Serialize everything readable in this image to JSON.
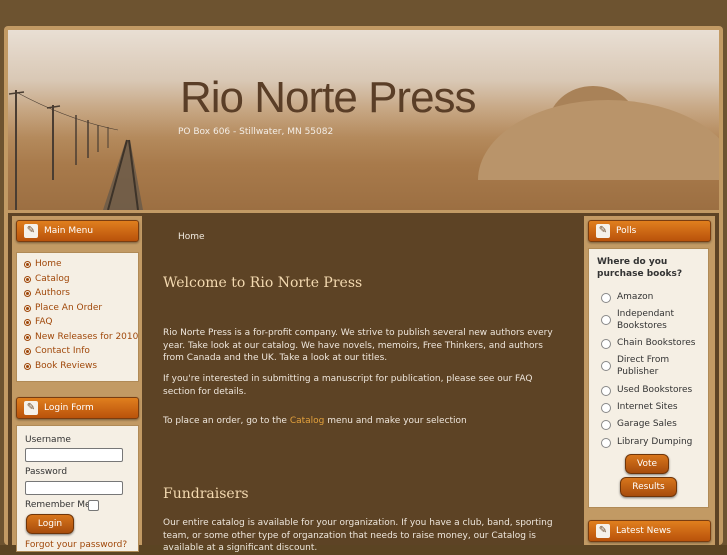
{
  "site": {
    "title": "Rio Norte Press",
    "address": "PO Box 606 - Stillwater, MN 55082"
  },
  "main_menu": {
    "title": "Main Menu",
    "items": [
      "Home",
      "Catalog",
      "Authors",
      "Place An Order",
      "FAQ",
      "New Releases for 2010",
      "Contact Info",
      "Book Reviews"
    ]
  },
  "login": {
    "title": "Login Form",
    "username_label": "Username",
    "password_label": "Password",
    "remember_label": "Remember Me",
    "login_button": "Login",
    "forgot_link": "Forgot your password?"
  },
  "breadcrumb": "Home",
  "content": {
    "welcome_title": "Welcome to Rio Norte Press",
    "intro": "Rio Norte Press is a for-profit company. We strive to publish several new authors every year. Take look at our catalog. We have novels, memoirs, Free Thinkers, and authors from Canada and the UK. Take a look at our titles.",
    "manuscript": "If you're interested in submitting a manuscript for publication, please see our FAQ section for details.",
    "order_before": "To place an order, go to the ",
    "order_link": "Catalog",
    "order_after": " menu and make your selection",
    "fundraisers_title": "Fundraisers",
    "fundraisers_text": "Our entire catalog is available for your organization.  If you have a club, band, sporting team, or some other type of organzation that needs to raise money, our Catalog is available at a significant discount."
  },
  "polls": {
    "title": "Polls",
    "question": "Where do you purchase books?",
    "options": [
      "Amazon",
      "Independant Bookstores",
      "Chain Bookstores",
      "Direct From Publisher",
      "Used Bookstores",
      "Internet Sites",
      "Garage Sales",
      "Library Dumping"
    ],
    "vote_button": "Vote",
    "results_button": "Results"
  },
  "latest_news": {
    "title": "Latest News"
  },
  "icons": {
    "module_icon": "pencil-icon",
    "list_bullet": "radio-bullet-icon"
  },
  "colors": {
    "accent": "#c9640f",
    "link": "#a0480a",
    "content_bg": "#5d4325"
  }
}
